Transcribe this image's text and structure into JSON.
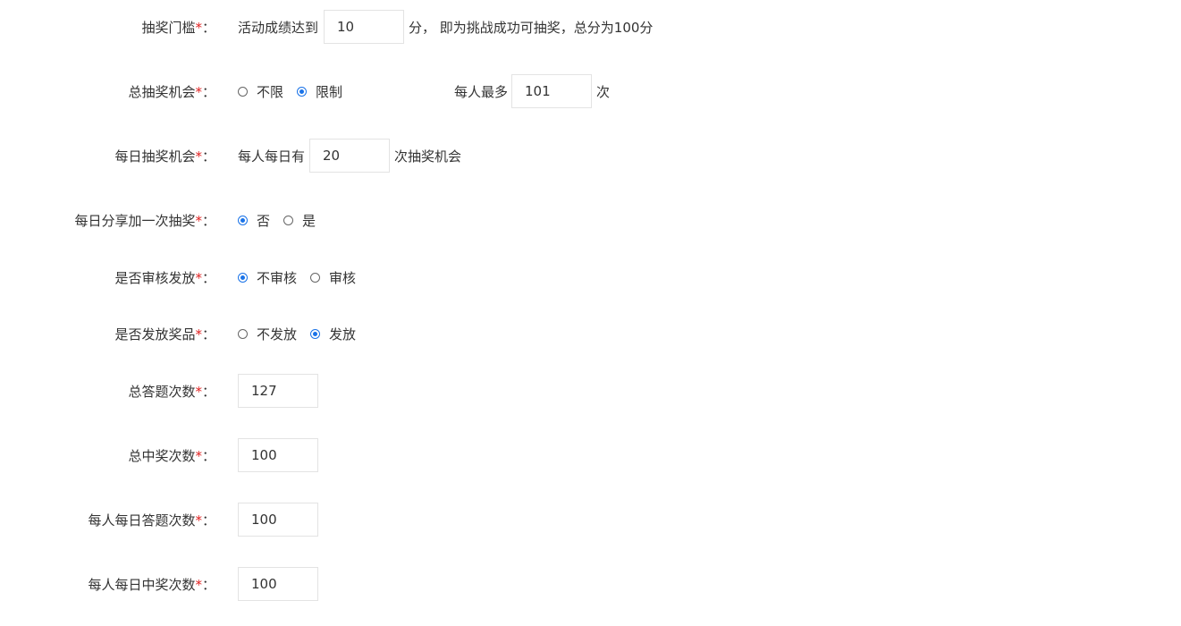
{
  "threshold": {
    "label": "抽奖门槛",
    "prefix": "活动成绩达到",
    "value": "10",
    "suffix": "分，  即为挑战成功可抽奖，总分为100分"
  },
  "total_chances": {
    "label": "总抽奖机会",
    "options": [
      {
        "label": "不限",
        "selected": false
      },
      {
        "label": "限制",
        "selected": true
      }
    ],
    "per_person_prefix": "每人最多",
    "per_person_value": "101",
    "per_person_suffix": "次"
  },
  "daily_chances": {
    "label": "每日抽奖机会",
    "prefix": "每人每日有",
    "value": "20",
    "suffix": "次抽奖机会"
  },
  "daily_share": {
    "label": "每日分享加一次抽奖",
    "options": [
      {
        "label": "否",
        "selected": true
      },
      {
        "label": "是",
        "selected": false
      }
    ]
  },
  "review": {
    "label": "是否审核发放",
    "options": [
      {
        "label": "不审核",
        "selected": true
      },
      {
        "label": "审核",
        "selected": false
      }
    ]
  },
  "issue_prize": {
    "label": "是否发放奖品",
    "options": [
      {
        "label": "不发放",
        "selected": false
      },
      {
        "label": "发放",
        "selected": true
      }
    ]
  },
  "total_answers": {
    "label": "总答题次数",
    "value": "127"
  },
  "total_wins": {
    "label": "总中奖次数",
    "value": "100"
  },
  "daily_answers": {
    "label": "每人每日答题次数",
    "value": "100"
  },
  "daily_wins": {
    "label": "每人每日中奖次数",
    "value": "100"
  },
  "required_mark": "*",
  "colon": "："
}
